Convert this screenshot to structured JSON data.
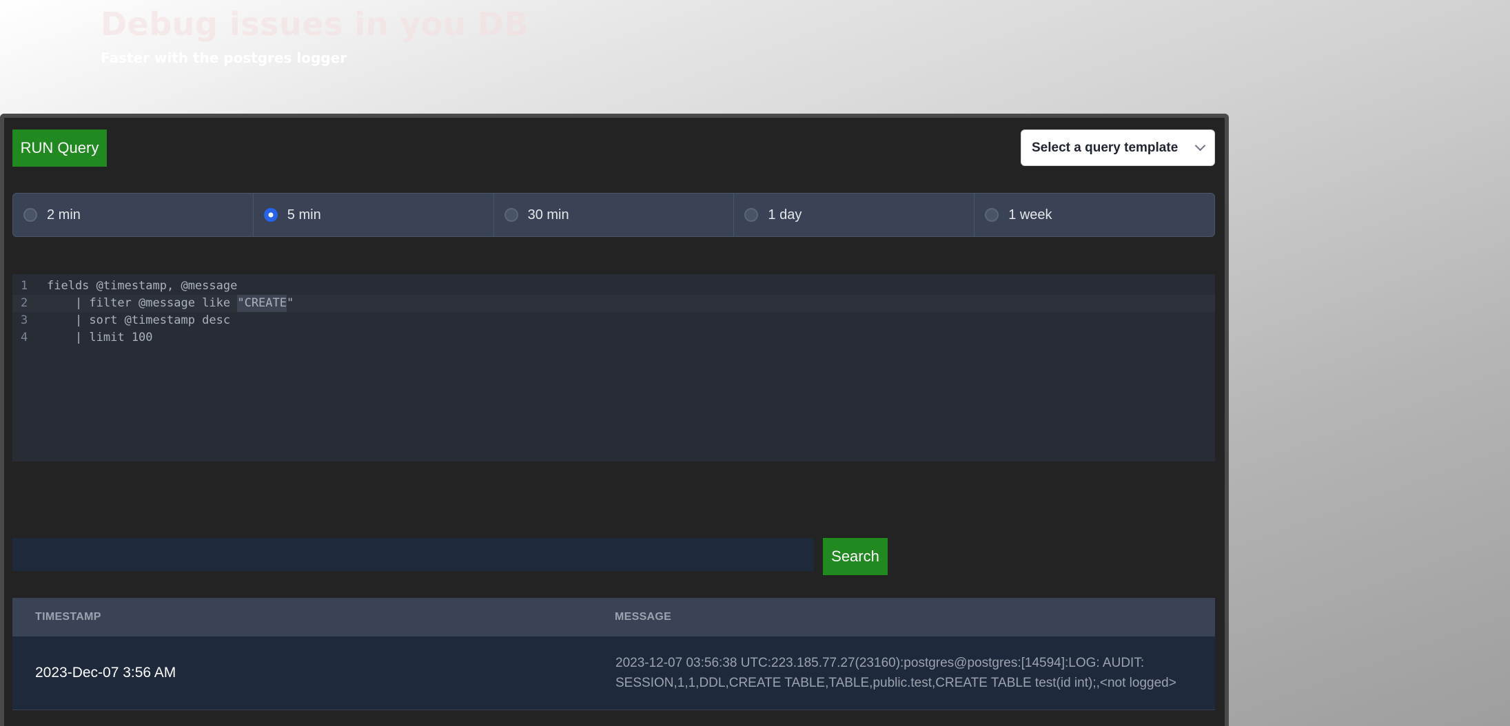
{
  "hero": {
    "title": "Debug issues in you DB",
    "subtitle": "Faster with the postgres logger"
  },
  "toolbar": {
    "run_label": "RUN Query",
    "template_placeholder": "Select a query template",
    "template_icon": "chevron-down-icon"
  },
  "time_ranges": {
    "selected": "5 min",
    "options": [
      {
        "label": "2 min",
        "checked": false
      },
      {
        "label": "5 min",
        "checked": true
      },
      {
        "label": "30 min",
        "checked": false
      },
      {
        "label": "1 day",
        "checked": false
      },
      {
        "label": "1 week",
        "checked": false
      }
    ]
  },
  "editor": {
    "lines": [
      {
        "num": "1",
        "text": "fields @timestamp, @message"
      },
      {
        "num": "2",
        "pre": "    | filter @message like ",
        "highlight": "\"CREATE",
        "post": "\""
      },
      {
        "num": "3",
        "text": "    | sort @timestamp desc"
      },
      {
        "num": "4",
        "text": "    | limit 100"
      }
    ]
  },
  "search": {
    "value": "",
    "placeholder": "",
    "button_label": "Search"
  },
  "results": {
    "columns": [
      "TIMESTAMP",
      "MESSAGE"
    ],
    "rows": [
      {
        "timestamp": "2023-Dec-07 3:56 AM",
        "message": "2023-12-07 03:56:38 UTC:223.185.77.27(23160):postgres@postgres:[14594]:LOG: AUDIT: SESSION,1,1,DDL,CREATE TABLE,TABLE,public.test,CREATE TABLE test(id int);,<not logged>"
      }
    ]
  },
  "colors": {
    "run_button": "#208a20",
    "search_button": "#208a20",
    "panel_bg": "#232323",
    "radio_selected": "#2563eb"
  }
}
